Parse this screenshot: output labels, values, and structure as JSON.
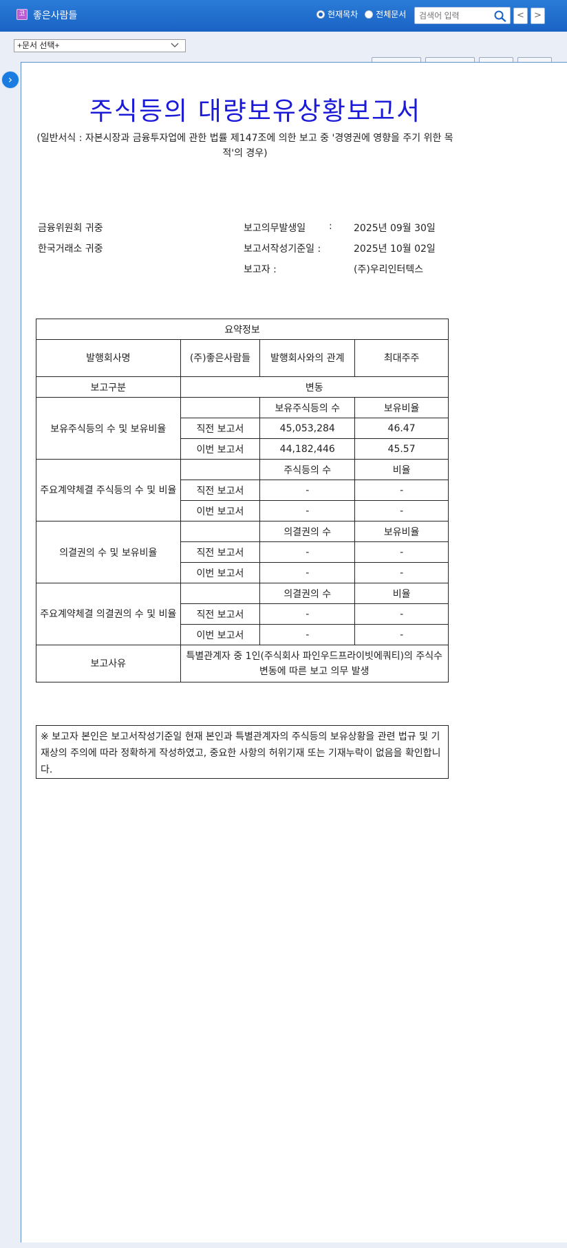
{
  "header": {
    "logo_glyph": "코",
    "company_name": "좋은사람들",
    "radio_current": "현재목차",
    "radio_all": "전체문서",
    "search_placeholder": "검색어 입력",
    "prev_label": "<",
    "next_label": ">"
  },
  "doc_select": {
    "selected": "+문서 선택+"
  },
  "sidebar": {
    "toggle_label": "›"
  },
  "document": {
    "title": "주식등의 대량보유상황보고서",
    "subtitle": "(일반서식 : 자본시장과 금융투자업에 관한 법률 제147조에 의한 보고 중 '경영권에 영향을 주기 위한 목적'의 경우)",
    "recipient_1": "금융위원회 귀중",
    "recipient_2": "한국거래소 귀중",
    "obligation_date_label": "보고의무발생일",
    "obligation_date_sep": ":",
    "obligation_date": "2025년 09월 30일",
    "base_date_label": "보고서작성기준일 :",
    "base_date": "2025년 10월 02일",
    "reporter_label": "보고자 :",
    "reporter": "(주)우리인터텍스"
  },
  "summary": {
    "header": "요약정보",
    "issuer_label": "발행회사명",
    "issuer": "(주)좋은사람들",
    "relation_label": "발행회사와의 관계",
    "relation": "최대주주",
    "report_type_label": "보고구분",
    "report_type": "변동",
    "holdings": {
      "label": "보유주식등의 수 및 보유비율",
      "col1": "보유주식등의 수",
      "col2": "보유비율",
      "prev_label": "직전 보고서",
      "prev_count": "45,053,284",
      "prev_ratio": "46.47",
      "curr_label": "이번 보고서",
      "curr_count": "44,182,446",
      "curr_ratio": "45.57"
    },
    "contract_shares": {
      "label": "주요계약체결 주식등의 수 및 비율",
      "col1": "주식등의 수",
      "col2": "비율",
      "prev_label": "직전 보고서",
      "prev_count": "-",
      "prev_ratio": "-",
      "curr_label": "이번 보고서",
      "curr_count": "-",
      "curr_ratio": "-"
    },
    "voting": {
      "label": "의결권의 수 및 보유비율",
      "col1": "의결권의 수",
      "col2": "보유비율",
      "prev_label": "직전 보고서",
      "prev_count": "-",
      "prev_ratio": "-",
      "curr_label": "이번 보고서",
      "curr_count": "-",
      "curr_ratio": "-"
    },
    "contract_voting": {
      "label": "주요계약체결 의결권의 수 및 비율",
      "col1": "의결권의 수",
      "col2": "비율",
      "prev_label": "직전 보고서",
      "prev_count": "-",
      "prev_ratio": "-",
      "curr_label": "이번 보고서",
      "curr_count": "-",
      "curr_ratio": "-"
    },
    "reason_label": "보고사유",
    "reason": "특별관계자 중 1인(주식회사 파인우드프라이빗에쿼티)의 주식수 변동에 따른 보고 의무 발생"
  },
  "notice": "※ 보고자 본인은 보고서작성기준일 현재 본인과 특별관계자의 주식등의 보유상황을 관련 법규 및 기재상의 주의에 따라 정확하게 작성하였고, 중요한 사항의 허위기재 또는 기재누락이 없음을 확인합니다.",
  "colors": {
    "header_blue": "#1a63c4",
    "title_blue": "#1a1ad8",
    "sidebar_button": "#1a7be0"
  },
  "icons": [
    "logo-icon",
    "search-icon",
    "chevron-down-icon",
    "chevron-left-icon",
    "chevron-right-icon"
  ]
}
